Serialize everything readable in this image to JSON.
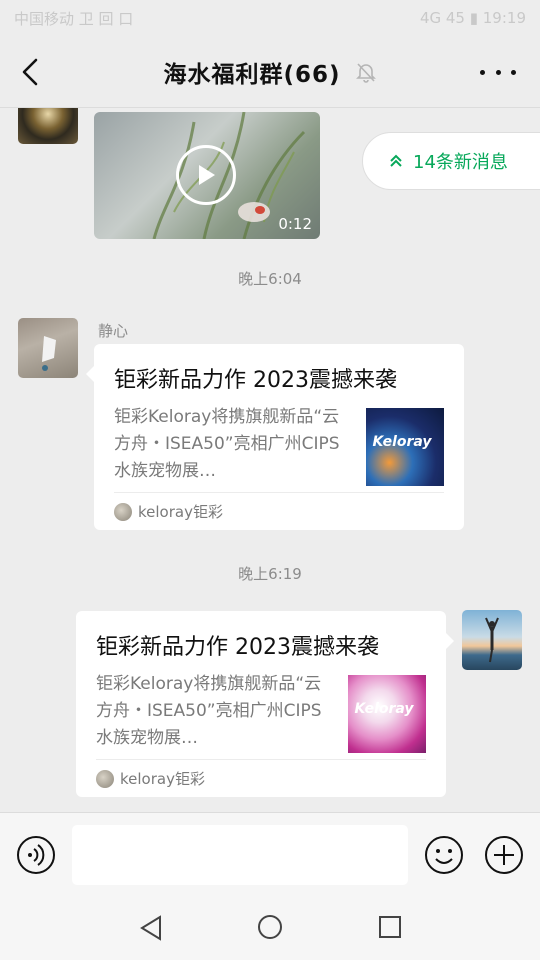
{
  "status_bar": {
    "left": "中国移动 卫 回 口",
    "right": "4G 45 ▮ 19:19"
  },
  "header": {
    "title": "海水福利群(66)"
  },
  "chat": {
    "new_messages": "14条新消息",
    "video": {
      "duration": "0:12"
    },
    "time1": "晚上6:04",
    "sender1": "静心",
    "card1": {
      "title": "钜彩新品力作 2023震撼来袭",
      "description": "钜彩Keloray将携旗舰新品“云方舟・ISEA50”亮相广州CIPS水族宠物展…",
      "thumb_brand": "Keloray",
      "source": "keloray钜彩"
    },
    "time2": "晚上6:19",
    "card2": {
      "title": "钜彩新品力作 2023震撼来袭",
      "description": "钜彩Keloray将携旗舰新品“云方舟・ISEA50”亮相广州CIPS水族宠物展…",
      "thumb_brand": "Keloray",
      "source": "keloray钜彩"
    }
  },
  "input": {
    "placeholder": ""
  },
  "colors": {
    "accent": "#07a85a",
    "background": "#ededed"
  }
}
